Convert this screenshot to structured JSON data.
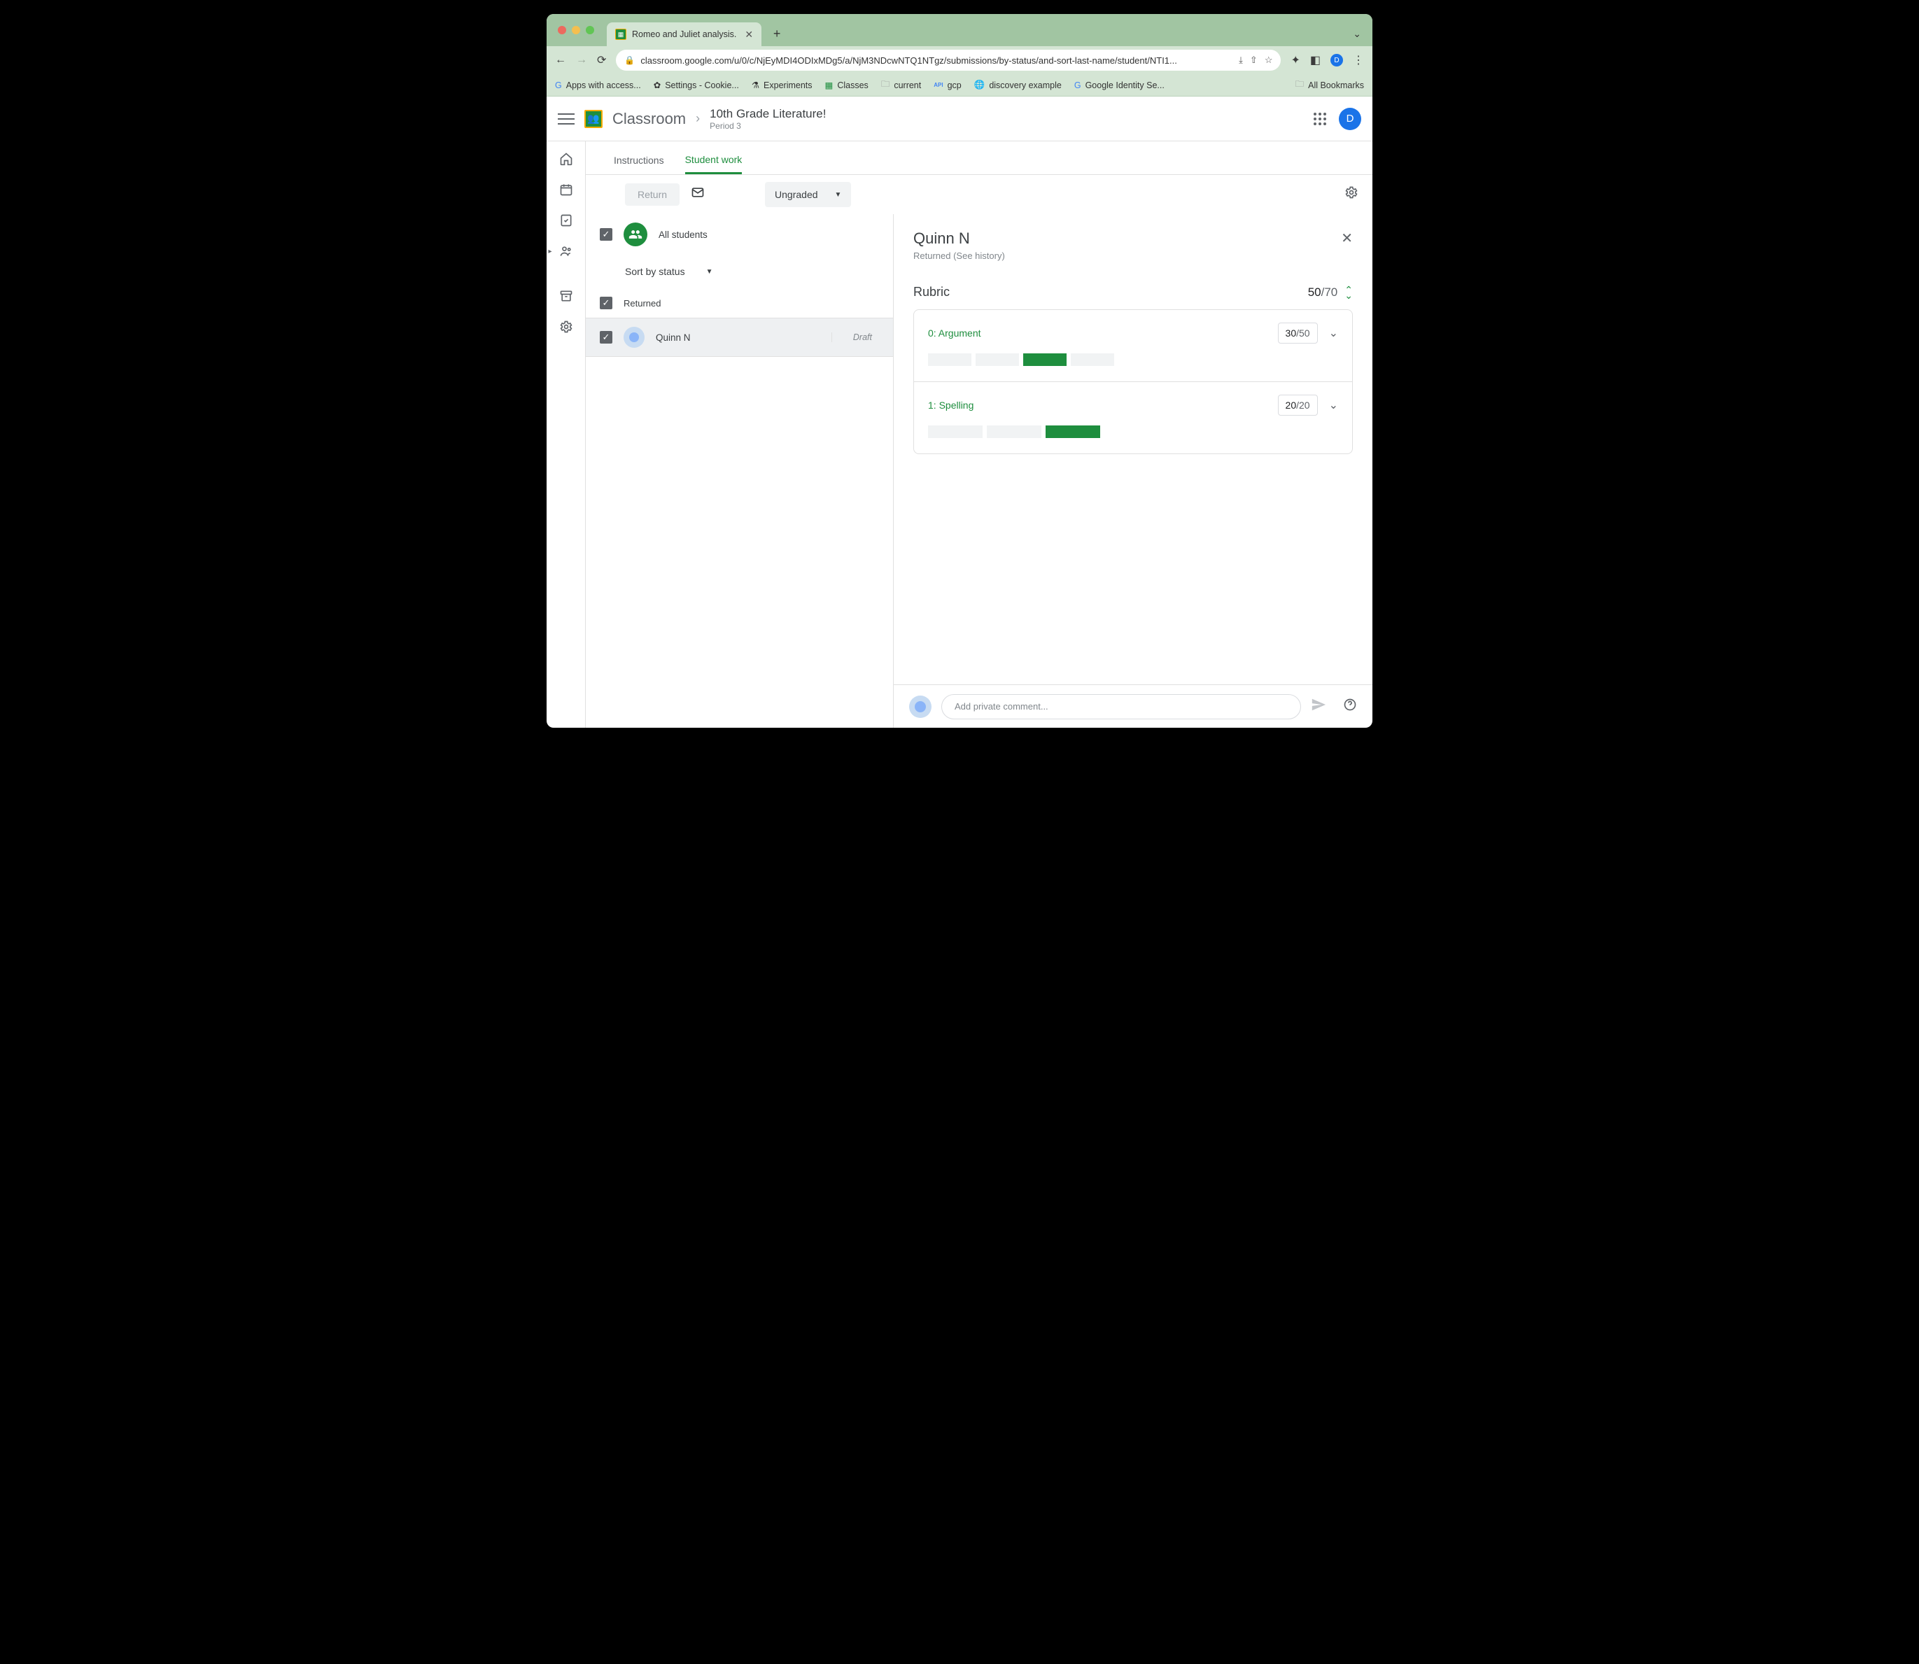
{
  "browser": {
    "tab_title": "Romeo and Juliet analysis.",
    "url": "classroom.google.com/u/0/c/NjEyMDI4ODIxMDg5/a/NjM3NDcwNTQ1NTgz/submissions/by-status/and-sort-last-name/student/NTI1...",
    "bookmarks": [
      "Apps with access...",
      "Settings - Cookie...",
      "Experiments",
      "Classes",
      "current",
      "gcp",
      "discovery example",
      "Google Identity Se..."
    ],
    "all_bookmarks": "All Bookmarks",
    "profile_initial": "D"
  },
  "header": {
    "app_name": "Classroom",
    "course_title": "10th Grade Literature!",
    "course_subtitle": "Period 3",
    "profile_initial": "D"
  },
  "tabs": {
    "instructions": "Instructions",
    "student_work": "Student work"
  },
  "actionbar": {
    "return_label": "Return",
    "filter_label": "Ungraded"
  },
  "studentlist": {
    "all_label": "All students",
    "sort_label": "Sort by status",
    "status_group": "Returned",
    "students": [
      {
        "name": "Quinn N",
        "status": "Draft"
      }
    ]
  },
  "detail": {
    "student_name": "Quinn N",
    "status": "Returned (See history)",
    "rubric_label": "Rubric",
    "rubric_score": "50",
    "rubric_max": "/70",
    "criteria": [
      {
        "name": "0: Argument",
        "score": "30",
        "max": "/50",
        "levels": 4,
        "selected": 2
      },
      {
        "name": "1: Spelling",
        "score": "20",
        "max": "/20",
        "levels": 3,
        "selected": 2
      }
    ],
    "comment_placeholder": "Add private comment..."
  }
}
